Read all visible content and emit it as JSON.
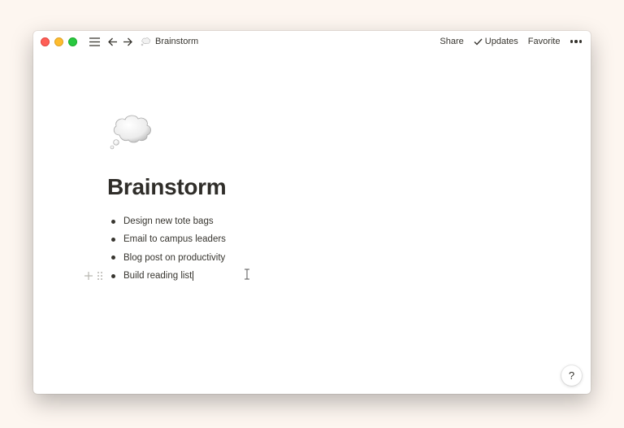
{
  "titlebar": {
    "breadcrumb": "Brainstorm",
    "share_label": "Share",
    "updates_label": "Updates",
    "favorite_label": "Favorite"
  },
  "page": {
    "icon": "thought-balloon-icon",
    "title": "Brainstorm",
    "bullets": [
      "Design new tote bags",
      "Email to campus leaders",
      "Blog post on productivity",
      "Build reading list"
    ]
  },
  "help": {
    "label": "?"
  },
  "colors": {
    "background": "#fdf6f0",
    "text": "#37352f",
    "close": "#ff5f57",
    "minimize": "#febc2e",
    "maximize": "#28c840",
    "handle": "#b8b6b1"
  }
}
